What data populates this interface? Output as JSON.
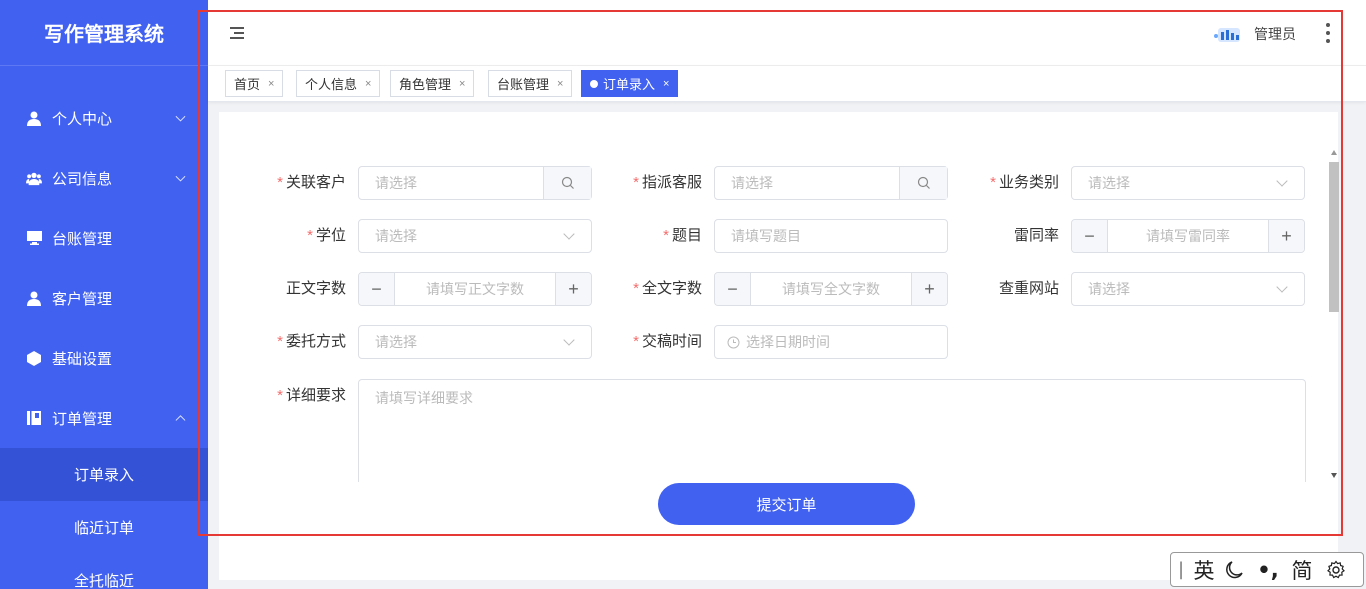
{
  "app": {
    "title": "写作管理系统"
  },
  "sidebar": {
    "items": [
      {
        "label": "个人中心",
        "icon": "user-icon",
        "expand": "down"
      },
      {
        "label": "公司信息",
        "icon": "users-icon",
        "expand": "down"
      },
      {
        "label": "台账管理",
        "icon": "monitor-icon"
      },
      {
        "label": "客户管理",
        "icon": "user-icon"
      },
      {
        "label": "基础设置",
        "icon": "cube-icon"
      },
      {
        "label": "订单管理",
        "icon": "ledger-icon",
        "expand": "up"
      }
    ],
    "sub_items": [
      {
        "label": "订单录入",
        "active": true
      },
      {
        "label": "临近订单"
      },
      {
        "label": "全托临近"
      }
    ]
  },
  "header": {
    "user": "管理员"
  },
  "tabs": [
    {
      "label": "首页"
    },
    {
      "label": "个人信息"
    },
    {
      "label": "角色管理"
    },
    {
      "label": "台账管理"
    },
    {
      "label": "订单录入",
      "active": true
    }
  ],
  "form": {
    "customer": {
      "label": "关联客户",
      "placeholder": "请选择"
    },
    "service": {
      "label": "指派客服",
      "placeholder": "请选择"
    },
    "business_type": {
      "label": "业务类别",
      "placeholder": "请选择"
    },
    "degree": {
      "label": "学位",
      "placeholder": "请选择"
    },
    "topic": {
      "label": "题目",
      "placeholder": "请填写题目"
    },
    "similarity": {
      "label": "雷同率",
      "placeholder": "请填写雷同率"
    },
    "body_words": {
      "label": "正文字数",
      "placeholder": "请填写正文字数"
    },
    "total_words": {
      "label": "全文字数",
      "placeholder": "请填写全文字数"
    },
    "check_site": {
      "label": "查重网站",
      "placeholder": "请选择"
    },
    "entrust": {
      "label": "委托方式",
      "placeholder": "请选择"
    },
    "deadline": {
      "label": "交稿时间",
      "placeholder": "选择日期时间"
    },
    "detail": {
      "label": "详细要求",
      "placeholder": "请填写详细要求"
    },
    "submit": "提交订单",
    "required_mark": "*",
    "minus": "−",
    "plus": "+"
  },
  "ime": {
    "mode": "英",
    "punct": "•,",
    "charset": "简"
  },
  "colors": {
    "primary": "#4161f0",
    "required": "#f56c6c",
    "highlight_frame": "#e53935"
  }
}
